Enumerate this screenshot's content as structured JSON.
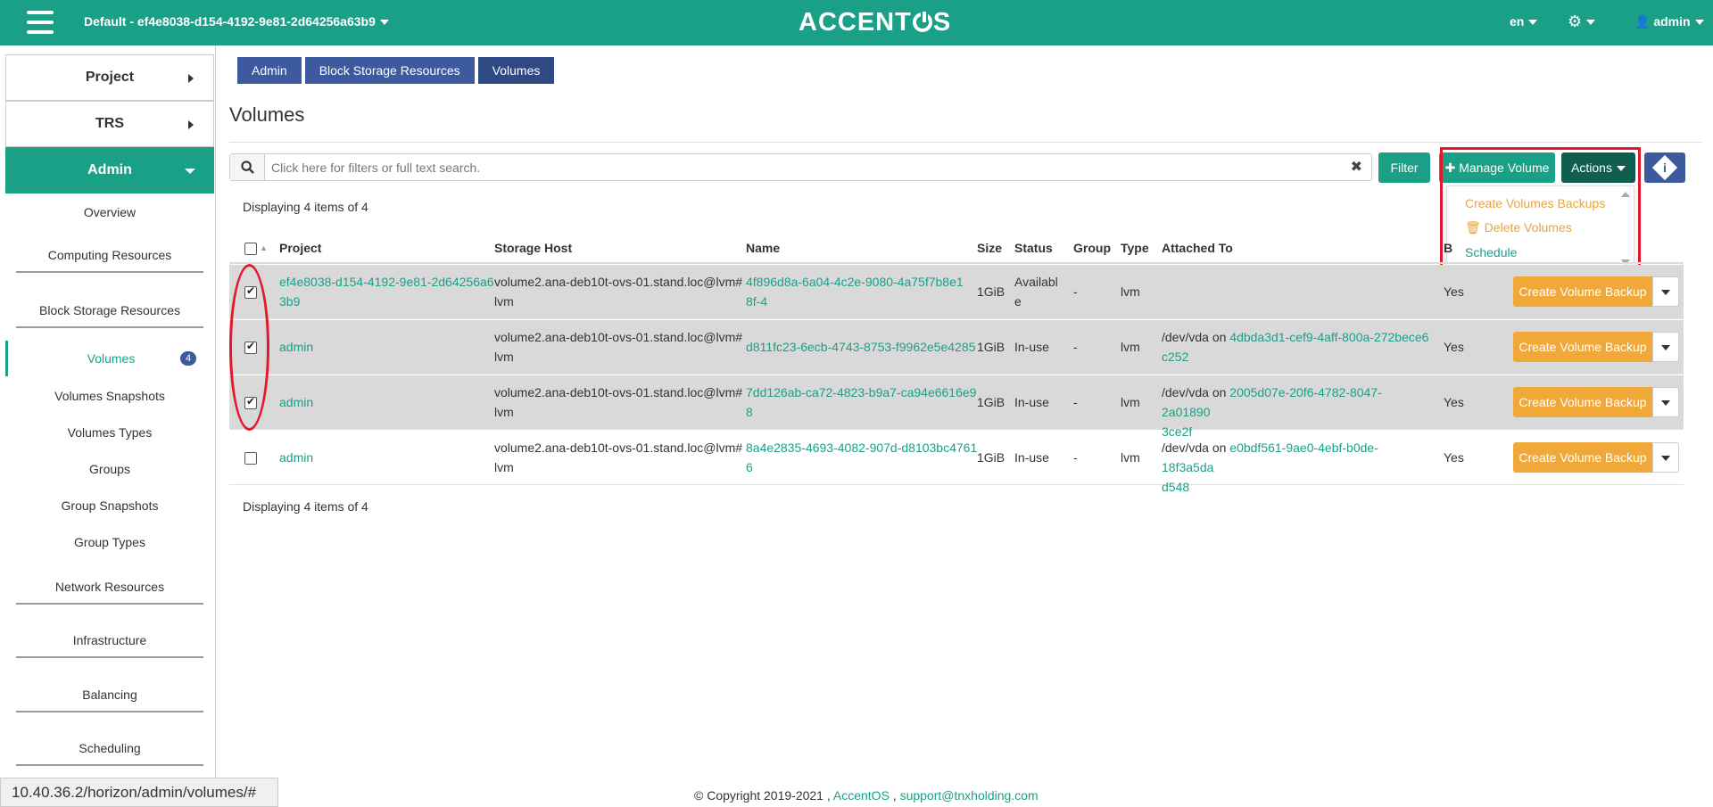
{
  "topbar": {
    "project": "Default - ef4e8038-d154-4192-9e81-2d64256a63b9",
    "logo": "ACCENTOS",
    "lang": "en",
    "user": "admin"
  },
  "sidebar": {
    "project": "Project",
    "trs": "TRS",
    "admin": "Admin",
    "items": {
      "overview": "Overview",
      "computing": "Computing Resources",
      "block_storage": "Block Storage Resources",
      "volumes": "Volumes",
      "volumes_badge": "4",
      "snapshots": "Volumes Snapshots",
      "types": "Volumes Types",
      "groups": "Groups",
      "group_snapshots": "Group Snapshots",
      "group_types": "Group Types",
      "network": "Network Resources",
      "infrastructure": "Infrastructure",
      "balancing": "Balancing",
      "scheduling": "Scheduling"
    }
  },
  "breadcrumb": [
    "Admin",
    "Block Storage Resources",
    "Volumes"
  ],
  "page_title": "Volumes",
  "search": {
    "placeholder": "Click here for filters or full text search."
  },
  "buttons": {
    "filter": "Filter",
    "manage": "Manage Volume",
    "actions": "Actions"
  },
  "actions_menu": {
    "create_backups": "Create Volumes Backups",
    "delete": "Delete Volumes",
    "schedule": "Schedule"
  },
  "display_count": "Displaying 4 items of 4",
  "table": {
    "headers": {
      "project": "Project",
      "host": "Storage Host",
      "name": "Name",
      "size": "Size",
      "status": "Status",
      "group": "Group",
      "type": "Type",
      "attached": "Attached To",
      "bootable_initial": "B"
    },
    "rows": [
      {
        "project_a": "ef4e8038-d154-4192-9e81-2d64256a6",
        "project_b": "3b9",
        "host_a": "volume2.ana-deb10t-ovs-01.stand.loc@lvm#",
        "host_b": "lvm",
        "name_a": "4f896d8a-6a04-4c2e-9080-4a75f7b8e1",
        "name_b": "8f-4",
        "size": "1GiB",
        "status_a": "Availabl",
        "status_b": "e",
        "group": "-",
        "type": "lvm",
        "attached_prefix": "",
        "attached_a": "",
        "attached_b": "",
        "bootable": "Yes",
        "action": "Create Volume Backup"
      },
      {
        "project_a": "admin",
        "host_a": "volume2.ana-deb10t-ovs-01.stand.loc@lvm#",
        "host_b": "lvm",
        "name_a": "d811fc23-6ecb-4743-8753-f9962e5e4285",
        "size": "1GiB",
        "status_a": "In-use",
        "group": "-",
        "type": "lvm",
        "attached_prefix": "/dev/vda on ",
        "attached_a": "4dbda3d1-cef9-4aff-800a-272bece6",
        "attached_b": "c252",
        "bootable": "Yes",
        "action": "Create Volume Backup"
      },
      {
        "project_a": "admin",
        "host_a": "volume2.ana-deb10t-ovs-01.stand.loc@lvm#",
        "host_b": "lvm",
        "name_a": "7dd126ab-ca72-4823-b9a7-ca94e6616e9",
        "name_b": "8",
        "size": "1GiB",
        "status_a": "In-use",
        "group": "-",
        "type": "lvm",
        "attached_prefix": "/dev/vda on ",
        "attached_a": "2005d07e-20f6-4782-8047-2a01890",
        "attached_b": "3ce2f",
        "bootable": "Yes",
        "action": "Create Volume Backup"
      },
      {
        "project_a": "admin",
        "host_a": "volume2.ana-deb10t-ovs-01.stand.loc@lvm#",
        "host_b": "lvm",
        "name_a": "8a4e2835-4693-4082-907d-d8103bc4761",
        "name_b": "6",
        "size": "1GiB",
        "status_a": "In-use",
        "group": "-",
        "type": "lvm",
        "attached_prefix": "/dev/vda on ",
        "attached_a": "e0bdf561-9ae0-4ebf-b0de-18f3a5da",
        "attached_b": "d548",
        "bootable": "Yes",
        "action": "Create Volume Backup"
      }
    ]
  },
  "statusbar": "10.40.36.2/horizon/admin/volumes/#",
  "footer": {
    "copy": "© Copyright 2019-2021 ,",
    "brand": "AccentOS",
    "sep": ",",
    "email": "support@tnxholding.com"
  },
  "colors": {
    "accent": "#1aa087",
    "primary": "#3e5a9e",
    "warning": "#f0a838",
    "highlight": "#e3182d"
  }
}
